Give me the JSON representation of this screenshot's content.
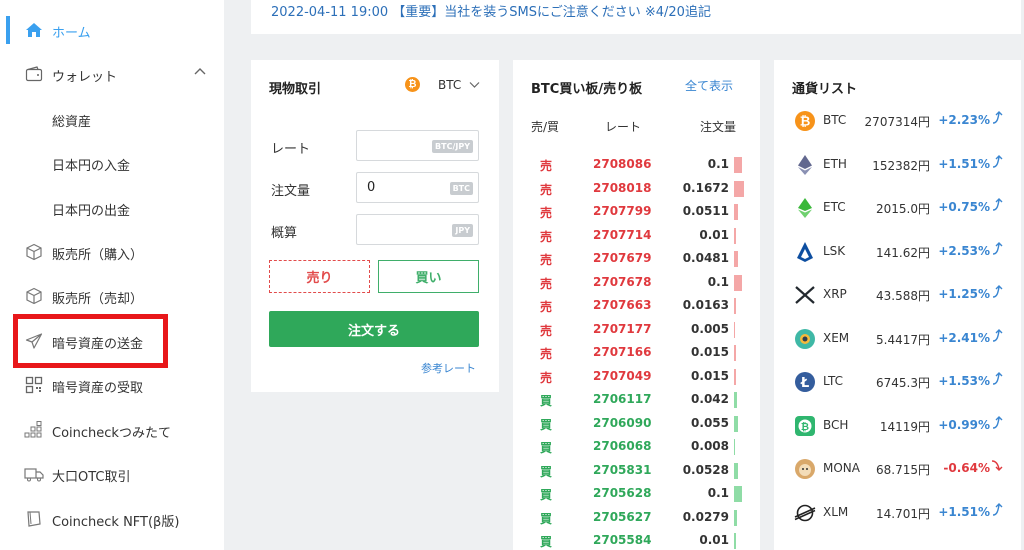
{
  "notice": {
    "text": "2022-04-11 19:00 【重要】当社を装うSMSにご注意ください ※4/20追記"
  },
  "sidebar": {
    "items": [
      {
        "label": "ホーム",
        "icon": "home-icon"
      },
      {
        "label": "ウォレット",
        "icon": "wallet-icon"
      },
      {
        "label": "総資産"
      },
      {
        "label": "日本円の入金"
      },
      {
        "label": "日本円の出金"
      },
      {
        "label": "販売所（購入）",
        "icon": "cube-icon"
      },
      {
        "label": "販売所（売却）",
        "icon": "cube-icon"
      },
      {
        "label": "暗号資産の送金",
        "icon": "send-icon"
      },
      {
        "label": "暗号資産の受取",
        "icon": "qr-icon"
      },
      {
        "label": "Coincheckつみたて",
        "icon": "stack-icon"
      },
      {
        "label": "大口OTC取引",
        "icon": "truck-icon"
      },
      {
        "label": "Coincheck NFT(β版)",
        "icon": "nft-icon"
      }
    ],
    "active_color": "#3aa0ef",
    "highlight_color": "#e8171a"
  },
  "trade": {
    "title": "現物取引",
    "coin": "BTC",
    "coin_badge": "₿",
    "rate_label": "レート",
    "rate_unit": "BTC/JPY",
    "amount_label": "注文量",
    "amount_value": "0",
    "amount_unit": "BTC",
    "estimate_label": "概算",
    "estimate_unit": "JPY",
    "sell_label": "売り",
    "buy_label": "買い",
    "order_label": "注文する",
    "ref_link": "参考レート"
  },
  "book": {
    "title": "BTC買い板/売り板",
    "show_all": "全て表示",
    "headers": {
      "side": "売/買",
      "rate": "レート",
      "qty": "注文量"
    },
    "rows": [
      {
        "side": "売",
        "type": "sell",
        "price": "2708086",
        "qty": "0.1"
      },
      {
        "side": "売",
        "type": "sell",
        "price": "2708018",
        "qty": "0.1672"
      },
      {
        "side": "売",
        "type": "sell",
        "price": "2707799",
        "qty": "0.0511"
      },
      {
        "side": "売",
        "type": "sell",
        "price": "2707714",
        "qty": "0.01"
      },
      {
        "side": "売",
        "type": "sell",
        "price": "2707679",
        "qty": "0.0481"
      },
      {
        "side": "売",
        "type": "sell",
        "price": "2707678",
        "qty": "0.1"
      },
      {
        "side": "売",
        "type": "sell",
        "price": "2707663",
        "qty": "0.0163"
      },
      {
        "side": "売",
        "type": "sell",
        "price": "2707177",
        "qty": "0.005"
      },
      {
        "side": "売",
        "type": "sell",
        "price": "2707166",
        "qty": "0.015"
      },
      {
        "side": "売",
        "type": "sell",
        "price": "2707049",
        "qty": "0.015"
      },
      {
        "side": "買",
        "type": "buy",
        "price": "2706117",
        "qty": "0.042"
      },
      {
        "side": "買",
        "type": "buy",
        "price": "2706090",
        "qty": "0.055"
      },
      {
        "side": "買",
        "type": "buy",
        "price": "2706068",
        "qty": "0.008"
      },
      {
        "side": "買",
        "type": "buy",
        "price": "2705831",
        "qty": "0.0528"
      },
      {
        "side": "買",
        "type": "buy",
        "price": "2705628",
        "qty": "0.1"
      },
      {
        "side": "買",
        "type": "buy",
        "price": "2705627",
        "qty": "0.0279"
      },
      {
        "side": "買",
        "type": "buy",
        "price": "2705584",
        "qty": "0.01"
      }
    ]
  },
  "coins": {
    "title": "通貨リスト",
    "items": [
      {
        "symbol": "BTC",
        "price": "2707314円",
        "change": "+2.23%",
        "dir": "up",
        "icon": "btc-icon",
        "color": "#f7931a"
      },
      {
        "symbol": "ETH",
        "price": "152382円",
        "change": "+1.51%",
        "dir": "up",
        "icon": "eth-icon",
        "color": "#62688f"
      },
      {
        "symbol": "ETC",
        "price": "2015.0円",
        "change": "+0.75%",
        "dir": "up",
        "icon": "etc-icon",
        "color": "#3ab83a"
      },
      {
        "symbol": "LSK",
        "price": "141.62円",
        "change": "+2.53%",
        "dir": "up",
        "icon": "lsk-icon",
        "color": "#0d4ea0"
      },
      {
        "symbol": "XRP",
        "price": "43.588円",
        "change": "+1.25%",
        "dir": "up",
        "icon": "xrp-icon",
        "color": "#23292f"
      },
      {
        "symbol": "XEM",
        "price": "5.4417円",
        "change": "+2.41%",
        "dir": "up",
        "icon": "xem-icon",
        "color": "#3fb8a6"
      },
      {
        "symbol": "LTC",
        "price": "6745.3円",
        "change": "+1.53%",
        "dir": "up",
        "icon": "ltc-icon",
        "color": "#345d9d"
      },
      {
        "symbol": "BCH",
        "price": "14119円",
        "change": "+0.99%",
        "dir": "up",
        "icon": "bch-icon",
        "color": "#2fb66f"
      },
      {
        "symbol": "MONA",
        "price": "68.715円",
        "change": "-0.64%",
        "dir": "down",
        "icon": "mona-icon",
        "color": "#d9a86a"
      },
      {
        "symbol": "XLM",
        "price": "14.701円",
        "change": "+1.51%",
        "dir": "up",
        "icon": "xlm-icon",
        "color": "#222222"
      }
    ]
  }
}
